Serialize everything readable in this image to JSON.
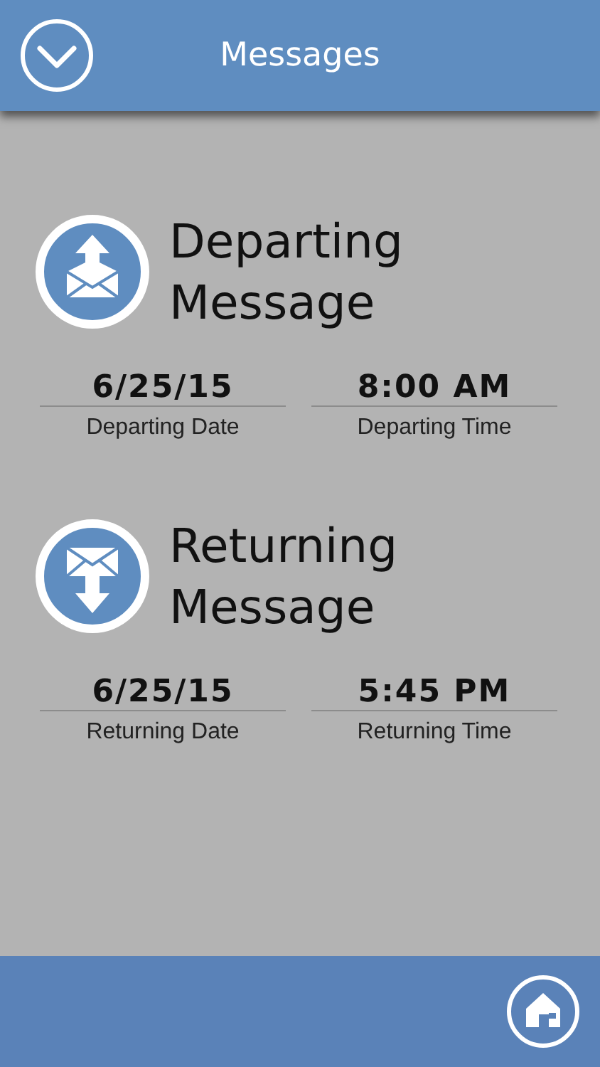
{
  "header": {
    "title": "Messages"
  },
  "sections": [
    {
      "kind": "departing",
      "title_lines": [
        "Departing",
        "Message"
      ],
      "fields": [
        {
          "value": "6/25/15",
          "label": "Departing Date"
        },
        {
          "value": "8:00 AM",
          "label": "Departing Time"
        }
      ]
    },
    {
      "kind": "returning",
      "title_lines": [
        "Returning",
        "Message"
      ],
      "fields": [
        {
          "value": "6/25/15",
          "label": "Returning Date"
        },
        {
          "value": "5:45 PM",
          "label": "Returning Time"
        }
      ]
    }
  ]
}
